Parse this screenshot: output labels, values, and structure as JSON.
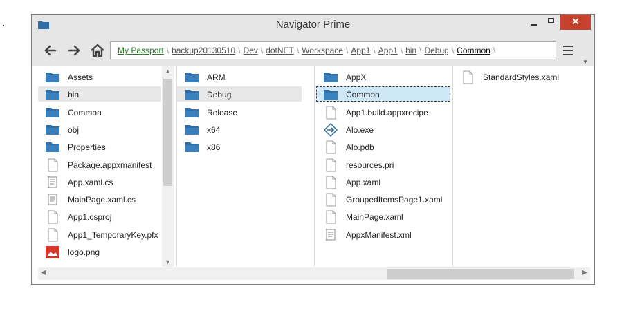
{
  "window": {
    "title": "Navigator Prime"
  },
  "breadcrumb": [
    "My Passport",
    "backup20130510",
    "Dev",
    "dotNET",
    "Workspace",
    "App1",
    "App1",
    "bin",
    "Debug",
    "Common"
  ],
  "columns": [
    {
      "items": [
        {
          "label": "Assets",
          "icon": "folder-icon",
          "selected": false
        },
        {
          "label": "bin",
          "icon": "folder-icon",
          "selected": "grey"
        },
        {
          "label": "Common",
          "icon": "folder-icon",
          "selected": false
        },
        {
          "label": "obj",
          "icon": "folder-icon",
          "selected": false
        },
        {
          "label": "Properties",
          "icon": "folder-icon",
          "selected": false
        },
        {
          "label": "Package.appxmanifest",
          "icon": "file-icon",
          "selected": false
        },
        {
          "label": "App.xaml.cs",
          "icon": "script-file-icon",
          "selected": false
        },
        {
          "label": "MainPage.xaml.cs",
          "icon": "script-file-icon",
          "selected": false
        },
        {
          "label": "App1.csproj",
          "icon": "file-icon",
          "selected": false
        },
        {
          "label": "App1_TemporaryKey.pfx",
          "icon": "file-icon",
          "selected": false
        },
        {
          "label": "logo.png",
          "icon": "image-file-icon",
          "selected": false
        }
      ]
    },
    {
      "items": [
        {
          "label": "ARM",
          "icon": "folder-icon",
          "selected": false
        },
        {
          "label": "Debug",
          "icon": "folder-icon",
          "selected": "grey"
        },
        {
          "label": "Release",
          "icon": "folder-icon",
          "selected": false
        },
        {
          "label": "x64",
          "icon": "folder-icon",
          "selected": false
        },
        {
          "label": "x86",
          "icon": "folder-icon",
          "selected": false
        }
      ]
    },
    {
      "items": [
        {
          "label": "AppX",
          "icon": "folder-icon",
          "selected": false
        },
        {
          "label": "Common",
          "icon": "folder-icon",
          "selected": "blue"
        },
        {
          "label": "App1.build.appxrecipe",
          "icon": "file-icon",
          "selected": false
        },
        {
          "label": "Alo.exe",
          "icon": "exe-icon",
          "selected": false
        },
        {
          "label": "Alo.pdb",
          "icon": "file-icon",
          "selected": false
        },
        {
          "label": "resources.pri",
          "icon": "file-icon",
          "selected": false
        },
        {
          "label": "App.xaml",
          "icon": "file-icon",
          "selected": false
        },
        {
          "label": "GroupedItemsPage1.xaml",
          "icon": "file-icon",
          "selected": false
        },
        {
          "label": "MainPage.xaml",
          "icon": "file-icon",
          "selected": false
        },
        {
          "label": "AppxManifest.xml",
          "icon": "script-file-icon",
          "selected": false
        }
      ]
    },
    {
      "items": [
        {
          "label": "StandardStyles.xaml",
          "icon": "file-icon",
          "selected": false
        }
      ]
    }
  ],
  "colors": {
    "folder": "#2f6ea6",
    "close": "#c7412f",
    "selectedBlue": "#cfe8f7",
    "selectedGrey": "#e8e8e8",
    "breadcrumbRoot": "#2d7d2d"
  }
}
